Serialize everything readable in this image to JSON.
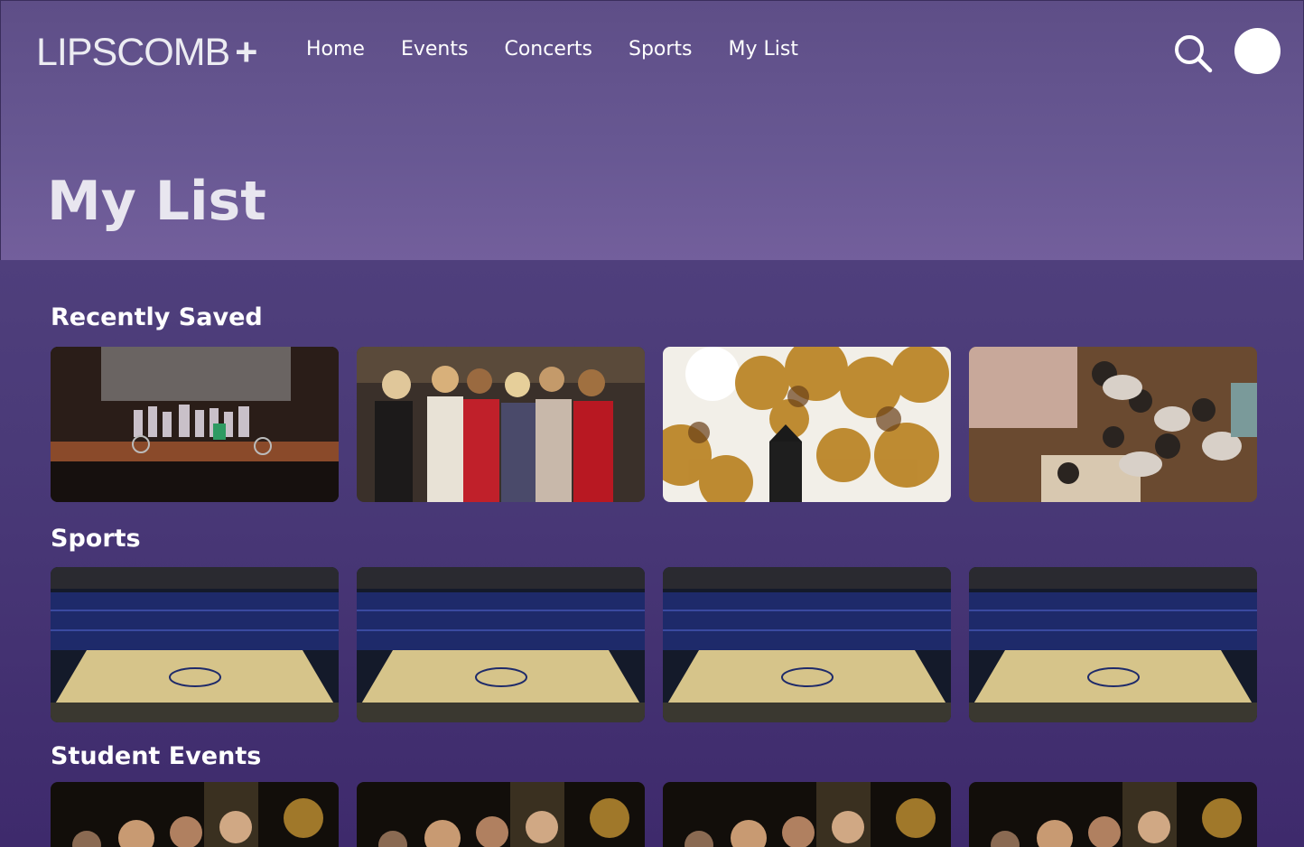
{
  "brand": {
    "name": "LIPSCOMB",
    "plus": "+"
  },
  "nav": {
    "links": [
      "Home",
      "Events",
      "Concerts",
      "Sports",
      "My List"
    ]
  },
  "header": {
    "search_icon": "search-icon",
    "avatar": "user-avatar"
  },
  "page": {
    "title": "My List"
  },
  "sections": [
    {
      "title": "Recently Saved",
      "cards": [
        "stage-performance",
        "group-formal-photo",
        "autumn-leaves-clocktower",
        "students-overhead"
      ]
    },
    {
      "title": "Sports",
      "cards": [
        "arena",
        "arena",
        "arena",
        "arena"
      ]
    },
    {
      "title": "Student Events",
      "cards": [
        "band-concert",
        "band-concert",
        "band-concert",
        "band-concert"
      ]
    }
  ],
  "colors": {
    "accent": "#4f3f7c",
    "hero": "#6a5a95",
    "text": "#ffffff"
  }
}
